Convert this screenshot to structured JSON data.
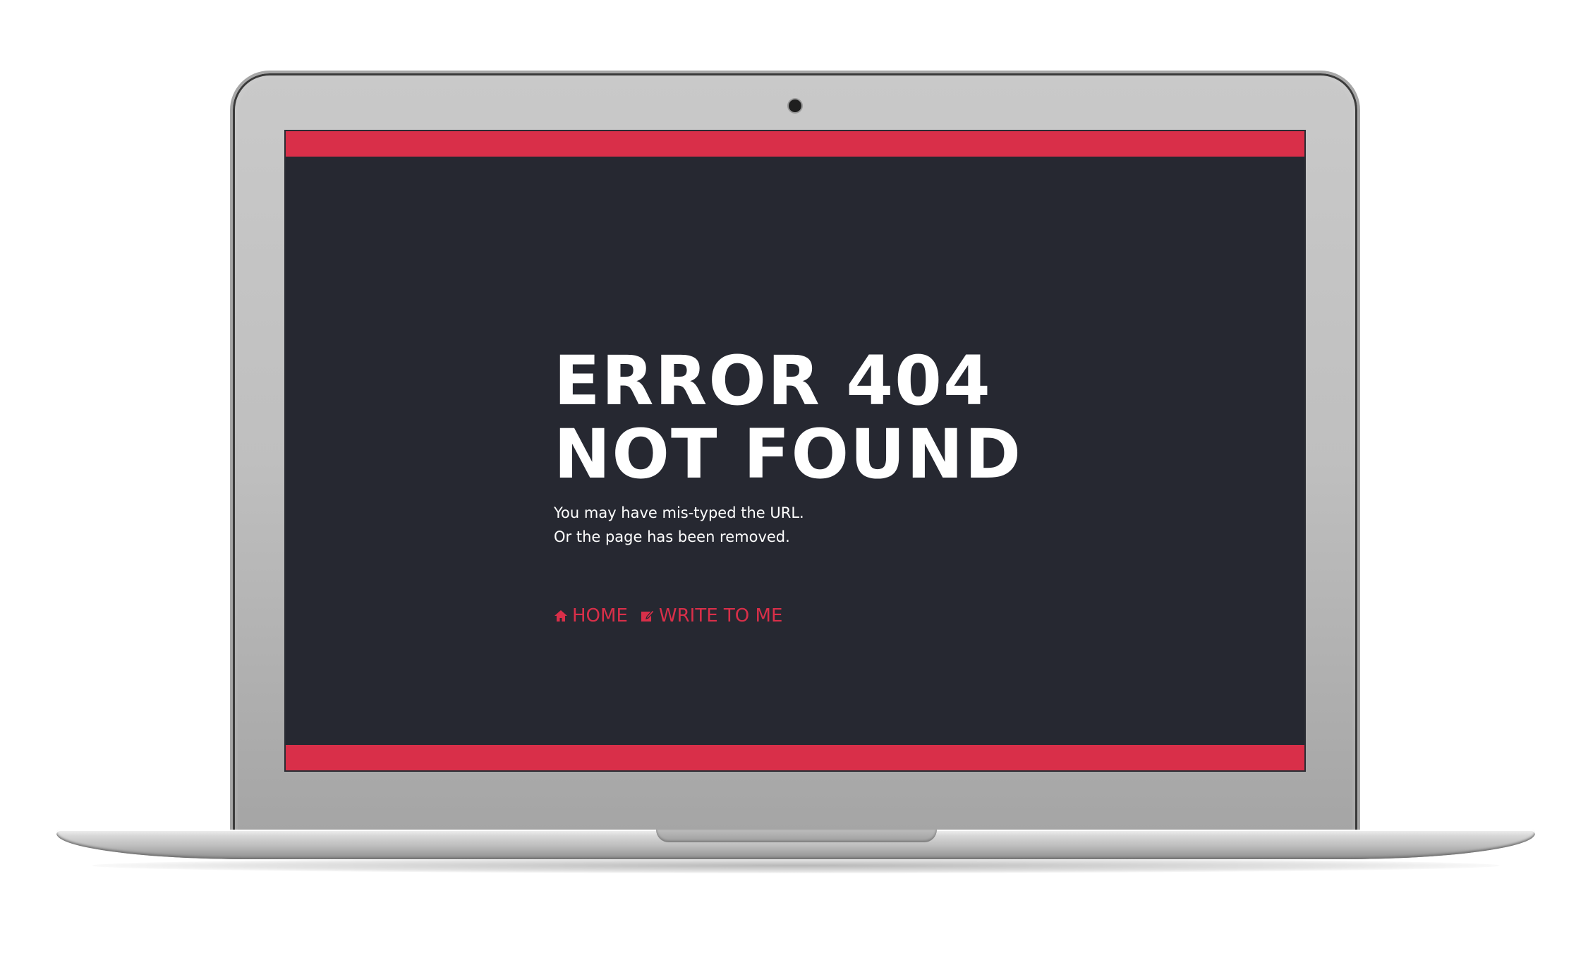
{
  "error": {
    "title_line1": "ERROR 404",
    "title_line2": "NOT FOUND",
    "message_line1": "You may have mis-typed the URL.",
    "message_line2": "Or the page has been removed."
  },
  "nav": {
    "home": {
      "label": "HOME",
      "icon": "home-icon"
    },
    "contact": {
      "label": "WRITE TO ME",
      "icon": "edit-icon"
    }
  },
  "colors": {
    "accent": "#d92f49",
    "screen_background": "#262831",
    "text": "#ffffff",
    "laptop_body": "#c4c4c4"
  }
}
